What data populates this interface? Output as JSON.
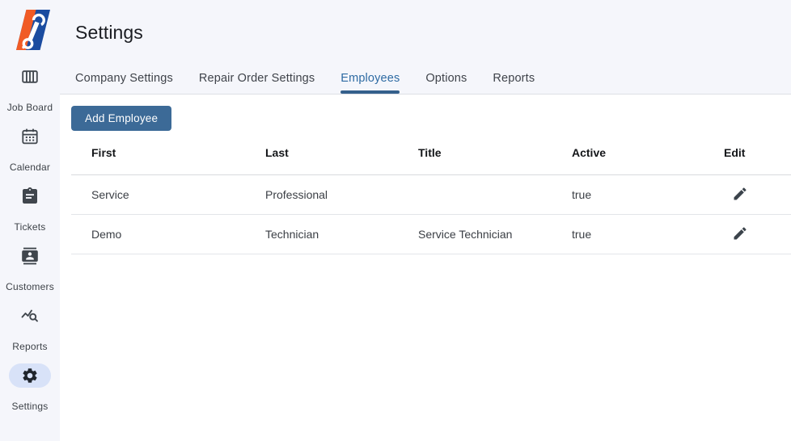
{
  "header": {
    "title": "Settings"
  },
  "sidebar": {
    "items": [
      {
        "label": "Job Board",
        "icon": "job-board-icon",
        "active": false
      },
      {
        "label": "Calendar",
        "icon": "calendar-icon",
        "active": false
      },
      {
        "label": "Tickets",
        "icon": "tickets-icon",
        "active": false
      },
      {
        "label": "Customers",
        "icon": "customers-icon",
        "active": false
      },
      {
        "label": "Reports",
        "icon": "reports-icon",
        "active": false
      },
      {
        "label": "Settings",
        "icon": "settings-gear-icon",
        "active": true
      }
    ]
  },
  "tabs": [
    {
      "label": "Company Settings",
      "active": false
    },
    {
      "label": "Repair Order Settings",
      "active": false
    },
    {
      "label": "Employees",
      "active": true
    },
    {
      "label": "Options",
      "active": false
    },
    {
      "label": "Reports",
      "active": false
    }
  ],
  "toolbar": {
    "add_employee_label": "Add Employee"
  },
  "table": {
    "columns": [
      "First",
      "Last",
      "Title",
      "Active",
      "Edit"
    ],
    "rows": [
      {
        "first": "Service",
        "last": "Professional",
        "title": "",
        "active": "true",
        "edit_icon": "pencil-icon"
      },
      {
        "first": "Demo",
        "last": "Technician",
        "title": "Service Technician",
        "active": "true",
        "edit_icon": "pencil-icon"
      }
    ]
  },
  "colors": {
    "accent_blue": "#2e6ba3",
    "tab_indicator": "#35608c",
    "button_blue": "#3c6a97",
    "logo_orange": "#f15b25",
    "logo_blue": "#1b4ca0",
    "sidebar_bg": "#f5f6fb",
    "active_pill": "#d8e2f8"
  }
}
